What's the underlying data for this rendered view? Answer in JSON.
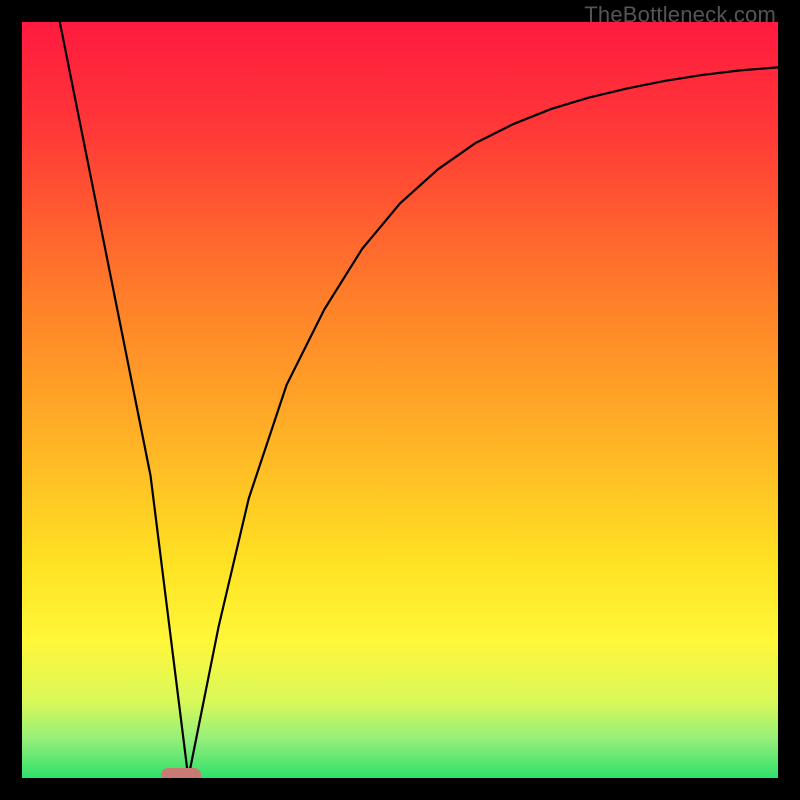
{
  "watermark": "TheBottleneck.com",
  "chart_data": {
    "type": "line",
    "title": "",
    "xlabel": "",
    "ylabel": "",
    "xlim": [
      0,
      100
    ],
    "ylim": [
      0,
      100
    ],
    "grid": false,
    "series": [
      {
        "name": "curve",
        "x": [
          5,
          9,
          13,
          17,
          19.5,
          22,
          26,
          30,
          35,
          40,
          45,
          50,
          55,
          60,
          65,
          70,
          75,
          80,
          85,
          90,
          95,
          100
        ],
        "values": [
          100,
          80,
          60,
          40,
          20,
          0,
          20,
          37,
          52,
          62,
          70,
          76,
          80.5,
          84,
          86.5,
          88.5,
          90,
          91.2,
          92.2,
          93,
          93.6,
          94
        ],
        "color": "#000000"
      }
    ],
    "marker": {
      "x": 21,
      "y": 0,
      "color": "#c97a72"
    },
    "background_gradient": {
      "stops": [
        {
          "offset": 0.0,
          "color": "#ff1a3f"
        },
        {
          "offset": 0.15,
          "color": "#ff3a37"
        },
        {
          "offset": 0.35,
          "color": "#ff7a2a"
        },
        {
          "offset": 0.55,
          "color": "#ffb225"
        },
        {
          "offset": 0.72,
          "color": "#ffe324"
        },
        {
          "offset": 0.82,
          "color": "#fff73a"
        },
        {
          "offset": 0.9,
          "color": "#d8f85a"
        },
        {
          "offset": 0.95,
          "color": "#92ef7a"
        },
        {
          "offset": 1.0,
          "color": "#2ee06a"
        }
      ]
    }
  }
}
